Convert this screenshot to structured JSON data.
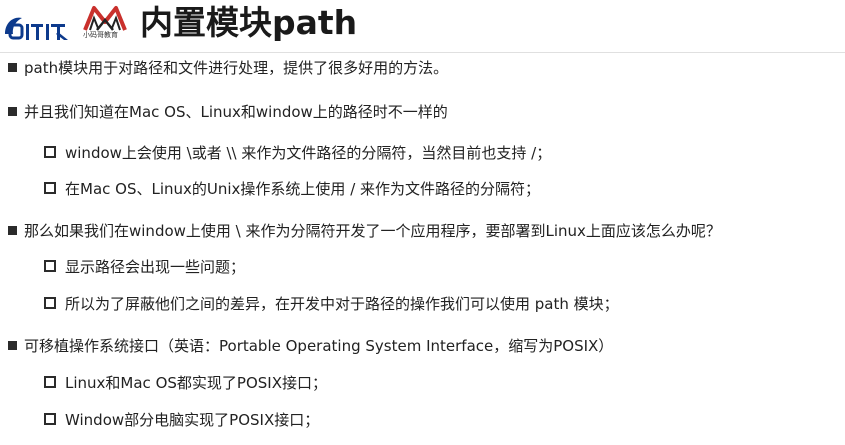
{
  "header": {
    "logo1_text": "codewhy",
    "logo2_caption": "小码哥教育",
    "title": "内置模块path"
  },
  "bullets": [
    {
      "level": 1,
      "text": "path模块用于对路径和文件进行处理，提供了很多好用的方法。"
    },
    {
      "level": 1,
      "text": "并且我们知道在Mac OS、Linux和window上的路径时不一样的"
    },
    {
      "level": 2,
      "text": "window上会使用 \\或者 \\\\ 来作为文件路径的分隔符，当然目前也支持 /；"
    },
    {
      "level": 2,
      "text": "在Mac OS、Linux的Unix操作系统上使用 / 来作为文件路径的分隔符；"
    },
    {
      "level": 1,
      "text": "那么如果我们在window上使用 \\ 来作为分隔符开发了一个应用程序，要部署到Linux上面应该怎么办呢？"
    },
    {
      "level": 2,
      "text": "显示路径会出现一些问题；"
    },
    {
      "level": 2,
      "text": "所以为了屏蔽他们之间的差异，在开发中对于路径的操作我们可以使用 path 模块；"
    },
    {
      "level": 1,
      "text": "可移植操作系统接口（英语：Portable Operating System Interface，缩写为POSIX）"
    },
    {
      "level": 2,
      "text": "Linux和Mac OS都实现了POSIX接口；"
    },
    {
      "level": 2,
      "text": "Window部分电脑实现了POSIX接口；"
    }
  ]
}
